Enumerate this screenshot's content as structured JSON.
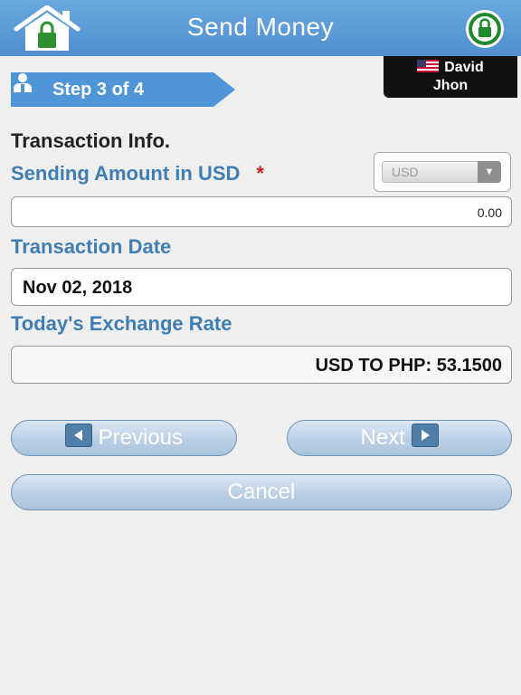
{
  "header": {
    "title": "Send Money"
  },
  "user": {
    "first_name": "David",
    "last_name": "Jhon"
  },
  "step": {
    "label": "Step 3 of 4"
  },
  "form": {
    "section_title": "Transaction Info.",
    "amount_label": "Sending Amount in USD",
    "required_marker": "*",
    "currency_selected": "USD",
    "amount_value": "0.00",
    "date_label": "Transaction Date",
    "date_value": "Nov 02, 2018",
    "rate_label": "Today's Exchange Rate",
    "rate_value": "USD TO PHP: 53.1500"
  },
  "buttons": {
    "previous": "Previous",
    "next": "Next",
    "cancel": "Cancel"
  },
  "icons": {
    "home": "home-lock-icon",
    "lock": "lock-icon",
    "step": "user-step-icon",
    "flag": "us-flag-icon",
    "prev_arrow": "arrow-left-icon",
    "next_arrow": "arrow-right-icon",
    "dropdown": "chevron-down-icon"
  },
  "colors": {
    "header": "#5b9bd8",
    "label": "#3f7eb3",
    "accent_green": "#1d8a2b",
    "required": "#c82020"
  }
}
